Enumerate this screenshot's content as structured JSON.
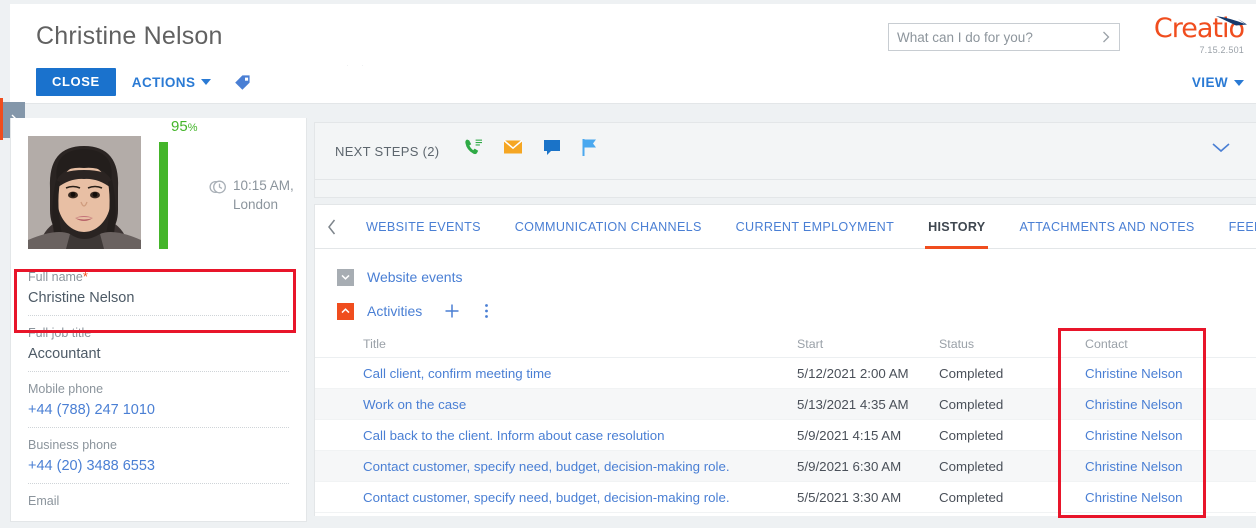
{
  "header": {
    "title": "Christine Nelson",
    "close_label": "CLOSE",
    "actions_label": "ACTIONS",
    "tag_icon": "tag-icon",
    "view_label": "VIEW"
  },
  "search": {
    "placeholder": "What can I do for you?",
    "value": "",
    "submit_icon": "chevron-right-icon"
  },
  "logo": {
    "brand": "Creatio",
    "version": "7.15.2.501",
    "brand_color": "#f04d1e",
    "arrow_color": "#16396b"
  },
  "left_panel": {
    "edge_toggle_icon": "chevron-right-icon",
    "avatar_name": "avatar",
    "completeness": {
      "value": "95",
      "symbol": "%",
      "percent": 95,
      "color": "#44b52a"
    },
    "local_time": {
      "clock_icon": "clock-globe-icon",
      "time": "10:15 AM,",
      "city": "London"
    },
    "fields": [
      {
        "label": "Full name",
        "required": true,
        "value": "Christine Nelson",
        "is_link": false
      },
      {
        "label": "Full job title",
        "required": false,
        "value": "Accountant",
        "is_link": false
      },
      {
        "label": "Mobile phone",
        "required": false,
        "value": "+44 (788) 247 1010",
        "is_link": true
      },
      {
        "label": "Business phone",
        "required": false,
        "value": "+44 (20) 3488 6553",
        "is_link": true
      },
      {
        "label": "Email",
        "required": false,
        "value": "",
        "is_link": true
      }
    ]
  },
  "next_steps": {
    "label": "NEXT STEPS (2)",
    "icons": [
      {
        "name": "phone-call-icon",
        "color": "#2eaa45"
      },
      {
        "name": "email-icon",
        "color": "#f5a623"
      },
      {
        "name": "chat-message-icon",
        "color": "#1a73c8"
      },
      {
        "name": "flag-icon",
        "color": "#4aa8ef"
      }
    ],
    "collapse_icon": "chevron-down-icon"
  },
  "tabs": {
    "scroll_left_icon": "chevron-left-icon",
    "scroll_right_icon": "chevron-right-icon",
    "items": [
      {
        "label": "WEBSITE EVENTS",
        "active": false
      },
      {
        "label": "COMMUNICATION CHANNELS",
        "active": false
      },
      {
        "label": "CURRENT EMPLOYMENT",
        "active": false
      },
      {
        "label": "HISTORY",
        "active": true
      },
      {
        "label": "ATTACHMENTS AND NOTES",
        "active": false
      },
      {
        "label": "FEED",
        "active": false
      }
    ]
  },
  "sections": {
    "website_events": {
      "title": "Website events",
      "toggle_icon": "chevron-down-icon",
      "expanded": false
    },
    "activities": {
      "title": "Activities",
      "toggle_icon": "chevron-up-icon",
      "expanded": true,
      "add_icon": "plus-icon",
      "menu_icon": "vertical-dots-icon"
    }
  },
  "activities_table": {
    "columns": [
      "Title",
      "Start",
      "Status",
      "Contact"
    ],
    "rows": [
      {
        "title": "Call client, confirm meeting time",
        "start": "5/12/2021 2:00 AM",
        "status": "Completed",
        "contact": "Christine Nelson"
      },
      {
        "title": "Work on the case",
        "start": "5/13/2021 4:35 AM",
        "status": "Completed",
        "contact": "Christine Nelson"
      },
      {
        "title": "Call back to the client. Inform about case resolution",
        "start": "5/9/2021 4:15 AM",
        "status": "Completed",
        "contact": "Christine Nelson"
      },
      {
        "title": "Contact customer, specify need, budget, decision-making role.",
        "start": "5/9/2021 6:30 AM",
        "status": "Completed",
        "contact": "Christine Nelson"
      },
      {
        "title": "Contact customer, specify need, budget, decision-making role.",
        "start": "5/5/2021 3:30 AM",
        "status": "Completed",
        "contact": "Christine Nelson"
      }
    ]
  },
  "annotations": {
    "highlight_color": "#e8152a",
    "boxes": [
      {
        "name": "full-name-field-highlight"
      },
      {
        "name": "contact-column-highlight"
      }
    ]
  }
}
